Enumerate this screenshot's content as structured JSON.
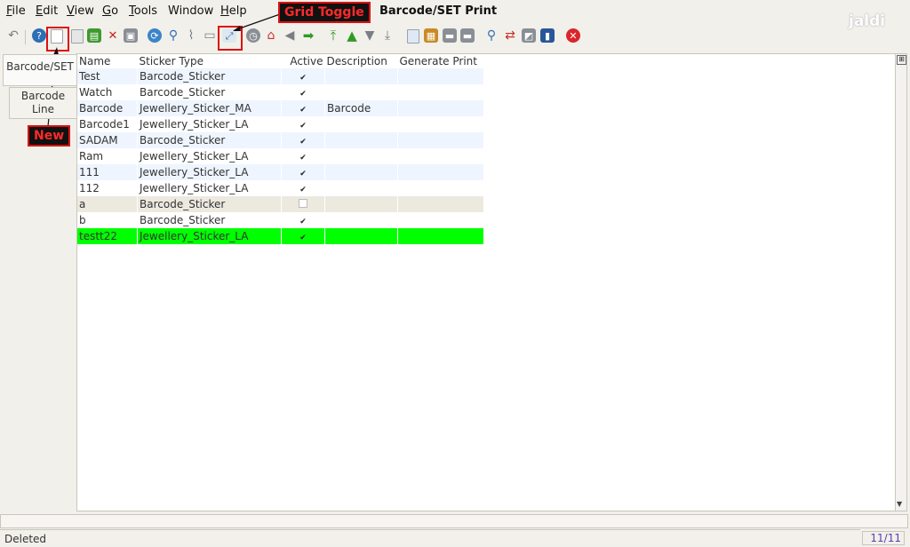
{
  "menu": {
    "items": [
      {
        "label": "File",
        "mnemonic": "F",
        "rest": "ile"
      },
      {
        "label": "Edit",
        "mnemonic": "E",
        "rest": "dit"
      },
      {
        "label": "View",
        "mnemonic": "V",
        "rest": "iew"
      },
      {
        "label": "Go",
        "mnemonic": "G",
        "rest": "o"
      },
      {
        "label": "Tools",
        "mnemonic": "T",
        "rest": "ools"
      },
      {
        "label": "Window",
        "mnemonic": "",
        "rest": "Window"
      },
      {
        "label": "Help",
        "mnemonic": "H",
        "rest": "elp"
      }
    ]
  },
  "window_title": "Barcode/SET Print",
  "logo_text": "jaldi",
  "toolbar": {
    "icons": [
      "undo-icon",
      "help-icon",
      "new-record-icon",
      "copy-record-icon",
      "save-icon",
      "delete-icon",
      "save-disabled-icon",
      "refresh-icon",
      "find-icon",
      "attachment-icon",
      "chat-icon",
      "grid-toggle-icon",
      "history-icon",
      "home-icon",
      "previous-icon",
      "next-icon",
      "first-record-icon",
      "previous-record-icon",
      "next-record-icon",
      "last-record-icon",
      "report-icon",
      "archive-icon",
      "print-preview-icon",
      "print-icon",
      "zoom-across-icon",
      "workflow-icon",
      "product-info-icon",
      "database-icon",
      "close-window-icon"
    ]
  },
  "callouts": {
    "grid_toggle": "Grid Toggle",
    "new": "New"
  },
  "tabs": [
    {
      "label": "Barcode/SET"
    },
    {
      "label": "Barcode\nLine"
    }
  ],
  "grid": {
    "columns": [
      "Name",
      "Sticker Type",
      "Active",
      "Description",
      "Generate Print"
    ],
    "rows": [
      {
        "name": "Test",
        "sticker_type": "Barcode_Sticker",
        "active": true,
        "description": "",
        "generate_print": ""
      },
      {
        "name": "Watch",
        "sticker_type": "Barcode_Sticker",
        "active": true,
        "description": "",
        "generate_print": ""
      },
      {
        "name": "Barcode",
        "sticker_type": "Jewellery_Sticker_MA",
        "active": true,
        "description": "Barcode",
        "generate_print": ""
      },
      {
        "name": "Barcode1",
        "sticker_type": "Jewellery_Sticker_LA",
        "active": true,
        "description": "",
        "generate_print": ""
      },
      {
        "name": "SADAM",
        "sticker_type": "Barcode_Sticker",
        "active": true,
        "description": "",
        "generate_print": ""
      },
      {
        "name": "Ram",
        "sticker_type": "Jewellery_Sticker_LA",
        "active": true,
        "description": "",
        "generate_print": ""
      },
      {
        "name": "111",
        "sticker_type": "Jewellery_Sticker_LA",
        "active": true,
        "description": "",
        "generate_print": ""
      },
      {
        "name": "112",
        "sticker_type": "Jewellery_Sticker_LA",
        "active": true,
        "description": "",
        "generate_print": ""
      },
      {
        "name": "a",
        "sticker_type": "Barcode_Sticker",
        "active": false,
        "description": "",
        "generate_print": ""
      },
      {
        "name": "b",
        "sticker_type": "Barcode_Sticker",
        "active": true,
        "description": "",
        "generate_print": ""
      },
      {
        "name": "testt22",
        "sticker_type": "Jewellery_Sticker_LA",
        "active": true,
        "description": "",
        "generate_print": ""
      }
    ]
  },
  "status": {
    "message": "Deleted",
    "record_count": "11/11"
  },
  "colors": {
    "current_row": "#00ff00",
    "callout_border": "#dd1111",
    "callout_text": "#ff2a2a"
  }
}
